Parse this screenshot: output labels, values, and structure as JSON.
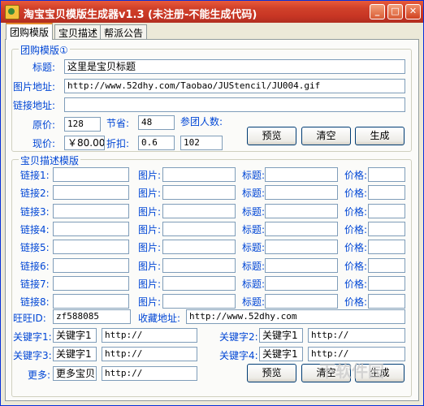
{
  "window": {
    "title": "淘宝宝贝模版生成器v1.3 (未注册-不能生成代码)"
  },
  "tabs": [
    "团购模版",
    "宝贝描述",
    "帮派公告"
  ],
  "group1": {
    "title": "团购模版①",
    "title_label": "标题:",
    "title_value": "这里是宝贝标题",
    "image_label": "图片地址:",
    "image_value": "http://www.52dhy.com/Taobao/JUStencil/JU004.gif",
    "link_label": "链接地址:",
    "link_value": "",
    "orig_price_label": "原价:",
    "orig_price_value": "128",
    "save_label": "节省:",
    "save_value": "48",
    "participants_label": "参团人数:",
    "participants_value": "102",
    "current_price_label": "现价:",
    "current_price_value": "￥80.00",
    "discount_label": "折扣:",
    "discount_value": "0.6",
    "preview_button": "预览",
    "clear_button": "清空",
    "generate_button": "生成"
  },
  "group2": {
    "title": "宝贝描述模版",
    "rows": [
      {
        "link_label": "链接1:",
        "image_label": "图片:",
        "title_label": "标题:",
        "price_label": "价格:"
      },
      {
        "link_label": "链接2:",
        "image_label": "图片:",
        "title_label": "标题:",
        "price_label": "价格:"
      },
      {
        "link_label": "链接3:",
        "image_label": "图片:",
        "title_label": "标题:",
        "price_label": "价格:"
      },
      {
        "link_label": "链接4:",
        "image_label": "图片:",
        "title_label": "标题:",
        "price_label": "价格:"
      },
      {
        "link_label": "链接5:",
        "image_label": "图片:",
        "title_label": "标题:",
        "price_label": "价格:"
      },
      {
        "link_label": "链接6:",
        "image_label": "图片:",
        "title_label": "标题:",
        "price_label": "价格:"
      },
      {
        "link_label": "链接7:",
        "image_label": "图片:",
        "title_label": "标题:",
        "price_label": "价格:"
      },
      {
        "link_label": "链接8:",
        "image_label": "图片:",
        "title_label": "标题:",
        "price_label": "价格:"
      }
    ],
    "wangwang_label": "旺旺ID:",
    "wangwang_value": "zf588085",
    "favorite_label": "收藏地址:",
    "favorite_value": "http://www.52dhy.com",
    "keywords": [
      {
        "label": "关键字1:",
        "word": "关键字1",
        "url": "http://"
      },
      {
        "label": "关键字2:",
        "word": "关键字1",
        "url": "http://"
      },
      {
        "label": "关键字3:",
        "word": "关键字1",
        "url": "http://"
      },
      {
        "label": "关键字4:",
        "word": "关键字1",
        "url": "http://"
      }
    ],
    "more_label": "更多:",
    "more_word": "更多宝贝",
    "more_url": "http://",
    "preview_button": "预览",
    "clear_button": "清空",
    "generate_button": "生成"
  },
  "watermark": "下软件园"
}
